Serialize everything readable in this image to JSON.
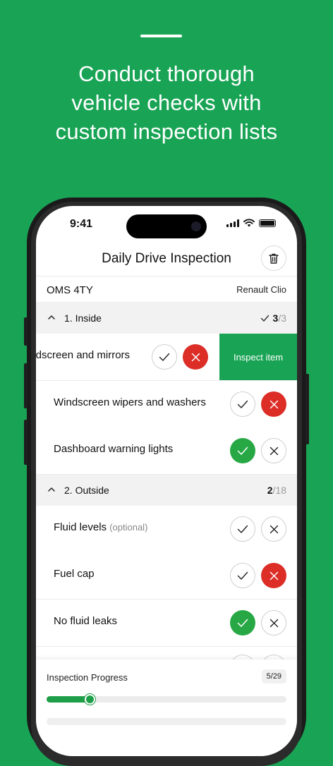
{
  "headline": [
    "Conduct thorough",
    "vehicle checks with",
    "custom inspection lists"
  ],
  "status_bar": {
    "time": "9:41"
  },
  "nav": {
    "title": "Daily Drive Inspection",
    "delete_icon": "trash-icon"
  },
  "vehicle": {
    "plate": "OMS 4TY",
    "model": "Renault Clio"
  },
  "sections": [
    {
      "label": "1. Inside",
      "done": "3",
      "total": "/3",
      "complete": true
    },
    {
      "label": "2. Outside",
      "done": "2",
      "total": "/18",
      "complete": false
    }
  ],
  "swiped_item": {
    "label": "indscreen and mirrors",
    "pass": "unselected",
    "fail": "selected",
    "action_label": "Inspect item"
  },
  "items": [
    {
      "label": "Windscreen wipers and washers",
      "optional": "",
      "pass": "unselected",
      "fail": "selected"
    },
    {
      "label": "Dashboard warning lights",
      "optional": "",
      "pass": "selected",
      "fail": "unselected"
    },
    {
      "label": "Fluid levels",
      "optional": "(optional)",
      "pass": "unselected",
      "fail": "unselected"
    },
    {
      "label": "Fuel cap",
      "optional": "",
      "pass": "unselected",
      "fail": "selected"
    },
    {
      "label": "No fluid leaks",
      "optional": "",
      "pass": "selected",
      "fail": "unselected"
    }
  ],
  "progress": {
    "label": "Inspection Progress",
    "badge": "5/29",
    "fraction": 0.18
  },
  "colors": {
    "brand": "#19a455",
    "pass": "#27a845",
    "fail": "#dc2d27"
  }
}
